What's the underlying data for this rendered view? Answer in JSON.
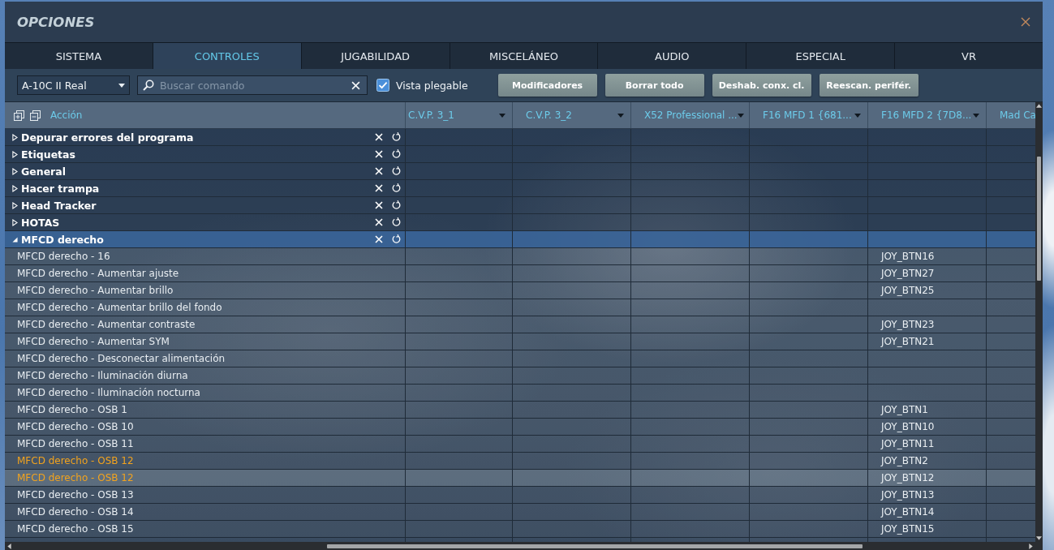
{
  "window": {
    "title": "OPCIONES"
  },
  "tabs": [
    {
      "label": "SISTEMA",
      "selected": false
    },
    {
      "label": "CONTROLES",
      "selected": true
    },
    {
      "label": "JUGABILIDAD",
      "selected": false
    },
    {
      "label": "MISCELÁNEO",
      "selected": false
    },
    {
      "label": "AUDIO",
      "selected": false
    },
    {
      "label": "ESPECIAL",
      "selected": false
    },
    {
      "label": "VR",
      "selected": false
    }
  ],
  "toolbar": {
    "aircraft": {
      "value": "A-10C II Real"
    },
    "search": {
      "placeholder": "Buscar comando"
    },
    "collapsible_view": {
      "label": "Vista plegable",
      "checked": true
    },
    "buttons": [
      "Modificadores",
      "Borrar todo",
      "Deshab. conx. cl.",
      "Reescan. perifér."
    ]
  },
  "table": {
    "columns": [
      {
        "kind": "action",
        "label": "Acción"
      },
      {
        "kind": "device",
        "label": "C.V.P. 3_1",
        "dropdown": true
      },
      {
        "kind": "device",
        "label": "C.V.P. 3_2",
        "dropdown": true
      },
      {
        "kind": "device",
        "label": "X52 Professional ...",
        "dropdown": true
      },
      {
        "kind": "device",
        "label": "F16 MFD 1 {681...",
        "dropdown": true
      },
      {
        "kind": "device",
        "label": "F16 MFD 2 {7D8...",
        "dropdown": true
      },
      {
        "kind": "device",
        "label": "Mad Ca"
      }
    ],
    "groups": [
      {
        "label": "Depurar errores del programa",
        "expanded": false,
        "selected": false
      },
      {
        "label": "Etiquetas",
        "expanded": false,
        "selected": false
      },
      {
        "label": "General",
        "expanded": false,
        "selected": false
      },
      {
        "label": "Hacer trampa",
        "expanded": false,
        "selected": false
      },
      {
        "label": "Head Tracker",
        "expanded": false,
        "selected": false
      },
      {
        "label": "HOTAS",
        "expanded": false,
        "selected": false
      },
      {
        "label": "MFCD derecho",
        "expanded": true,
        "selected": true,
        "children": [
          {
            "label": "MFCD derecho - 16",
            "conflict": false,
            "selected": false,
            "cells": [
              null,
              null,
              null,
              null,
              "JOY_BTN16",
              null
            ]
          },
          {
            "label": "MFCD derecho - Aumentar ajuste",
            "conflict": false,
            "selected": false,
            "cells": [
              null,
              null,
              null,
              null,
              "JOY_BTN27",
              null
            ]
          },
          {
            "label": "MFCD derecho - Aumentar brillo",
            "conflict": false,
            "selected": false,
            "cells": [
              null,
              null,
              null,
              null,
              "JOY_BTN25",
              null
            ]
          },
          {
            "label": "MFCD derecho - Aumentar brillo del fondo",
            "conflict": false,
            "selected": false
          },
          {
            "label": "MFCD derecho - Aumentar contraste",
            "conflict": false,
            "selected": false,
            "cells": [
              null,
              null,
              null,
              null,
              "JOY_BTN23",
              null
            ]
          },
          {
            "label": "MFCD derecho - Aumentar SYM",
            "conflict": false,
            "selected": false,
            "cells": [
              null,
              null,
              null,
              null,
              "JOY_BTN21",
              null
            ]
          },
          {
            "label": "MFCD derecho - Desconectar alimentación",
            "conflict": false,
            "selected": false
          },
          {
            "label": "MFCD derecho - Iluminación diurna",
            "conflict": false,
            "selected": false
          },
          {
            "label": "MFCD derecho - Iluminación nocturna",
            "conflict": false,
            "selected": false
          },
          {
            "label": "MFCD derecho - OSB 1",
            "conflict": false,
            "selected": false,
            "cells": [
              null,
              null,
              null,
              null,
              "JOY_BTN1",
              null
            ]
          },
          {
            "label": "MFCD derecho - OSB 10",
            "conflict": false,
            "selected": false,
            "cells": [
              null,
              null,
              null,
              null,
              "JOY_BTN10",
              null
            ]
          },
          {
            "label": "MFCD derecho - OSB 11",
            "conflict": false,
            "selected": false,
            "cells": [
              null,
              null,
              null,
              null,
              "JOY_BTN11",
              null
            ]
          },
          {
            "label": "MFCD derecho - OSB 12",
            "conflict": true,
            "selected": false,
            "cells": [
              null,
              null,
              null,
              null,
              "JOY_BTN2",
              null
            ]
          },
          {
            "label": "MFCD derecho - OSB 12",
            "conflict": true,
            "selected": true,
            "cells": [
              null,
              null,
              null,
              null,
              "JOY_BTN12",
              null
            ]
          },
          {
            "label": "MFCD derecho - OSB 13",
            "conflict": false,
            "selected": false,
            "cells": [
              null,
              null,
              null,
              null,
              "JOY_BTN13",
              null
            ]
          },
          {
            "label": "MFCD derecho - OSB 14",
            "conflict": false,
            "selected": false,
            "cells": [
              null,
              null,
              null,
              null,
              "JOY_BTN14",
              null
            ]
          },
          {
            "label": "MFCD derecho - OSB 15",
            "conflict": false,
            "selected": false,
            "cells": [
              null,
              null,
              null,
              null,
              "JOY_BTN15",
              null
            ]
          }
        ]
      }
    ]
  }
}
